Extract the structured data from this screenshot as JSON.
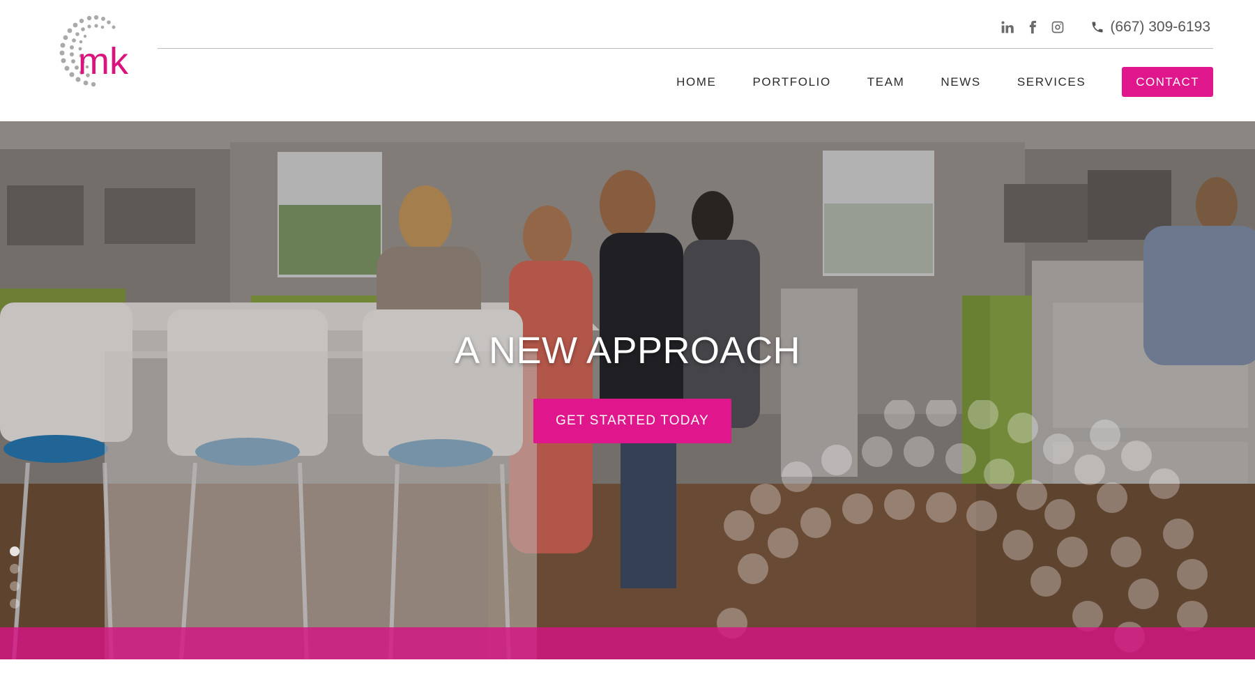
{
  "brand": {
    "logo_text": "mk",
    "accent_color": "#e0168c",
    "logo_dot_color": "#a9a9a9"
  },
  "topbar": {
    "social": [
      {
        "name": "linkedin-icon"
      },
      {
        "name": "facebook-icon"
      },
      {
        "name": "instagram-icon"
      }
    ],
    "phone": "(667) 309-6193"
  },
  "nav": {
    "items": [
      {
        "label": "HOME"
      },
      {
        "label": "PORTFOLIO"
      },
      {
        "label": "TEAM"
      },
      {
        "label": "NEWS"
      },
      {
        "label": "SERVICES"
      }
    ],
    "contact_label": "CONTACT"
  },
  "hero": {
    "title": "A NEW APPROACH",
    "cta_label": "GET STARTED TODAY",
    "slide_count": 4,
    "active_slide": 1
  }
}
